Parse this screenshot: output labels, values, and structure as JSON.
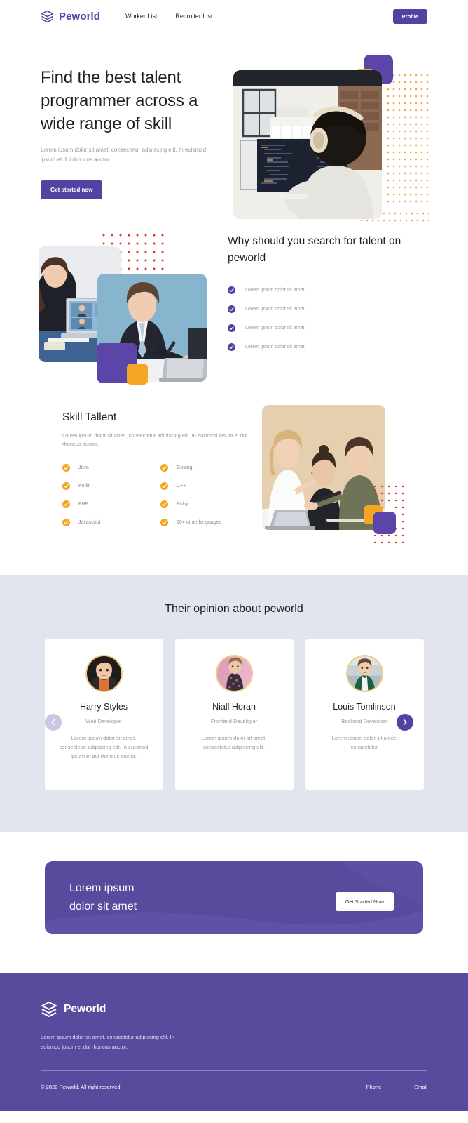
{
  "header": {
    "brand": "Peworld",
    "logo_icon": "layers-icon",
    "nav": [
      {
        "label": "Worker List"
      },
      {
        "label": "Recruiter List"
      }
    ],
    "profile_label": "Profile"
  },
  "hero": {
    "title": "Find the best talent programmer across a wide range of skill",
    "subtitle": "Lorem ipsum dolor sit amet, consectetur adipiscing elit. In euismod ipsum et dui rhoncus auctor.",
    "cta_label": "Get started now",
    "image_alt": "programmer-with-headphones-at-dual-monitors"
  },
  "why": {
    "title": "Why should you search for talent on peworld",
    "items": [
      {
        "text": "Lorem ipsum dolor sit amet.",
        "icon": "check-circle-icon"
      },
      {
        "text": "Lorem ipsum dolor sit amet.",
        "icon": "check-circle-icon"
      },
      {
        "text": "Lorem ipsum dolor sit amet.",
        "icon": "check-circle-icon"
      },
      {
        "text": "Lorem ipsum dolor sit amet.",
        "icon": "check-circle-icon"
      }
    ],
    "image_a_alt": "woman-on-video-call-with-laptop",
    "image_b_alt": "man-in-suit-at-desk-with-laptop"
  },
  "skill": {
    "title": "Skill Tallent",
    "subtitle": "Lorem ipsum dolor sit amet, consectetur adipiscing elit. In euismod ipsum et dui rhoncus auctor.",
    "items": [
      {
        "label": "Java"
      },
      {
        "label": "Golang"
      },
      {
        "label": "Kotlin"
      },
      {
        "label": "C++"
      },
      {
        "label": "PHP"
      },
      {
        "label": "Ruby"
      },
      {
        "label": "Javascript"
      },
      {
        "label": "10+ other languages"
      }
    ],
    "image_alt": "three-colleagues-reviewing-laptop"
  },
  "testimonials": {
    "title": "Their opinion about peworld",
    "prev_icon": "chevron-left-icon",
    "next_icon": "chevron-right-icon",
    "cards": [
      {
        "name": "Harry Styles",
        "role": "Web Developer",
        "quote": "Lorem ipsum dolor sit amet, consectetur adipiscing elit. In euismod ipsum et dui rhoncus auctor.",
        "avatar_alt": "portrait-harry-styles"
      },
      {
        "name": "Niall Horan",
        "role": "Frontend Developer",
        "quote": "Lorem ipsum dolor sit amet, consectetur adipiscing elit.",
        "avatar_alt": "portrait-niall-horan"
      },
      {
        "name": "Louis Tomlinson",
        "role": "Backend Developer",
        "quote": "Lorem ipsum dolor sit amet, consectetur",
        "avatar_alt": "portrait-louis-tomlinson"
      }
    ]
  },
  "cta_banner": {
    "line1": "Lorem ipsum",
    "line2": "dolor sit amet",
    "button_label": "Get Started Now"
  },
  "footer": {
    "brand": "Peworld",
    "logo_icon": "layers-icon",
    "description": "Lorem ipsum dolor sit amet, consectetur adipiscing elit. In euismod ipsum et dui rhoncus auctor.",
    "copyright": "© 2022 Peworld. All right reserved",
    "links": [
      {
        "label": "Phone"
      },
      {
        "label": "Email"
      }
    ]
  },
  "colors": {
    "brand_purple": "#5242a2",
    "accent_purple": "#5b45a8",
    "footer_purple": "#5a4a9e",
    "accent_orange": "#f5a623",
    "dot_orange": "#f2a93b",
    "dot_red": "#e03427",
    "testimonial_bg": "#e2e5ee",
    "avatar_ring": "#f5cd7e",
    "muted_text": "#9a9a9f"
  }
}
